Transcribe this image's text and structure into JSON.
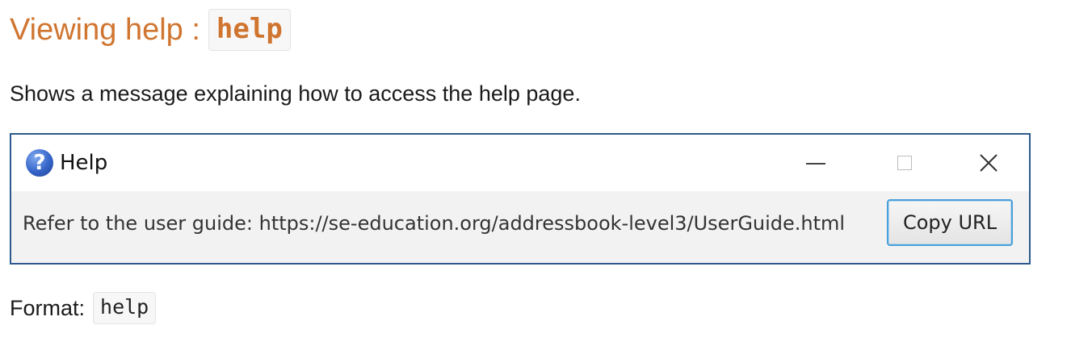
{
  "section": {
    "heading_text": "Viewing help :",
    "heading_code": "help",
    "description": "Shows a message explaining how to access the help page."
  },
  "window": {
    "icon": "help-question-icon",
    "title": "Help",
    "message": "Refer to the user guide: https://se-education.org/addressbook-level3/UserGuide.html",
    "copy_button_label": "Copy URL",
    "controls": [
      "minimize",
      "maximize",
      "close"
    ]
  },
  "format": {
    "label": "Format:",
    "code": "help"
  },
  "colors": {
    "heading": "#d07530",
    "window_border": "#2d5a8e",
    "button_focus": "#4aa0d8"
  }
}
